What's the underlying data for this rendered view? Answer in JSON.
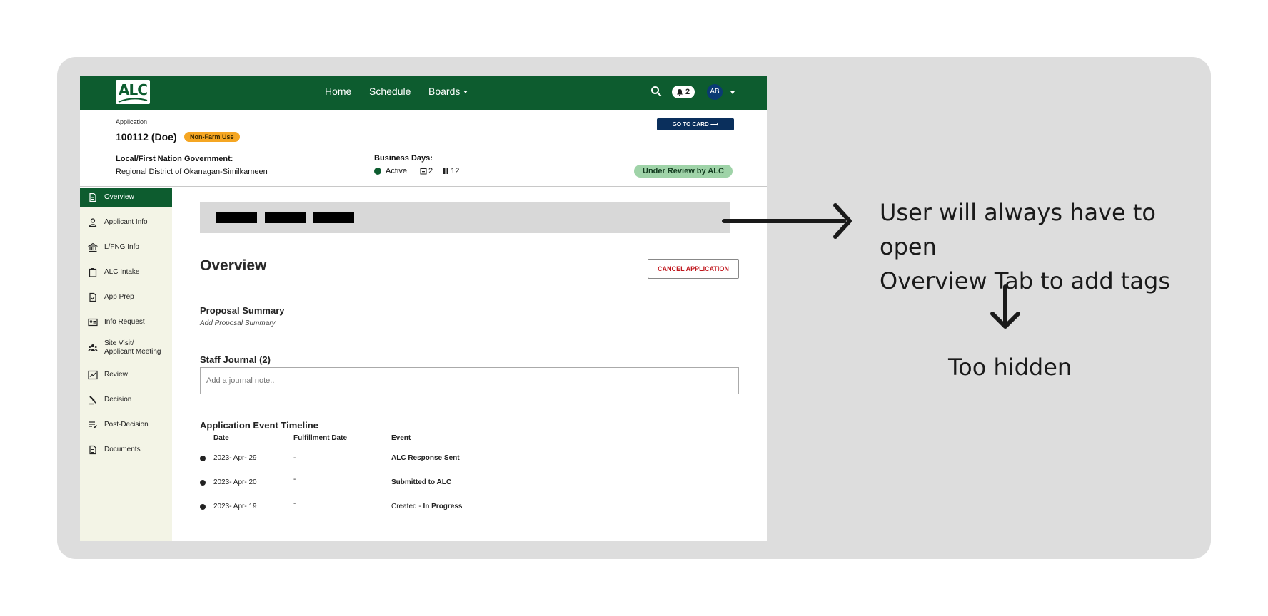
{
  "topnav": {
    "logo_text": "ALC",
    "links": [
      "Home",
      "Schedule",
      "Boards"
    ],
    "notification_count": "2",
    "avatar_initials": "AB"
  },
  "header": {
    "small_label": "Application",
    "title": "100112 (Doe)",
    "type_badge": "Non-Farm Use",
    "go_to_card": "GO TO CARD ⟶",
    "gov_label": "Local/First Nation Government:",
    "gov_value": "Regional District of Okanagan-Similkameen",
    "business_days_label": "Business Days:",
    "status_active": "Active",
    "calendar_days": "2",
    "paused_days": "12",
    "status_pill": "Under Review by ALC"
  },
  "sidebar": {
    "items": [
      {
        "label": "Overview",
        "icon": "file-icon",
        "active": true
      },
      {
        "label": "Applicant Info",
        "icon": "person-icon"
      },
      {
        "label": "L/FNG Info",
        "icon": "bank-icon"
      },
      {
        "label": "ALC Intake",
        "icon": "clipboard-icon"
      },
      {
        "label": "App Prep",
        "icon": "file-check-icon"
      },
      {
        "label": "Info Request",
        "icon": "id-card-icon"
      },
      {
        "label": "Site Visit/\nApplicant Meeting",
        "label_line1": "Site Visit/",
        "label_line2": "Applicant Meeting",
        "icon": "group-icon"
      },
      {
        "label": "Review",
        "icon": "signature-icon"
      },
      {
        "label": "Decision",
        "icon": "gavel-icon"
      },
      {
        "label": "Post-Decision",
        "icon": "edit-list-icon"
      },
      {
        "label": "Documents",
        "icon": "document-icon"
      }
    ]
  },
  "main": {
    "title": "Overview",
    "cancel_button": "CANCEL APPLICATION",
    "proposal_title": "Proposal Summary",
    "proposal_placeholder": "Add Proposal Summary",
    "journal_title": "Staff Journal (2)",
    "journal_placeholder": "Add a journal note..",
    "timeline_title": "Application Event Timeline",
    "timeline_headers": [
      "Date",
      "Fulfillment Date",
      "Event"
    ],
    "timeline_rows": [
      {
        "date": "2023- Apr- 29",
        "fulfillment": "-",
        "event_prefix": "",
        "event_bold": "ALC Response Sent"
      },
      {
        "date": "2023- Apr- 20",
        "fulfillment": "-",
        "event_prefix": "",
        "event_bold": "Submitted to ALC"
      },
      {
        "date": "2023- Apr- 19",
        "fulfillment": "-",
        "event_prefix": "Created - ",
        "event_bold": "In Progress"
      }
    ]
  },
  "annotation": {
    "line1": "User will always have to open",
    "line2": "Overview Tab to add tags",
    "conclusion": "Too hidden"
  },
  "colors": {
    "brand_green": "#0d5c2f",
    "navy": "#0a2f5c",
    "badge_orange": "#f5a623",
    "status_green": "#9fd3a8",
    "cancel_red": "#c0171d"
  }
}
